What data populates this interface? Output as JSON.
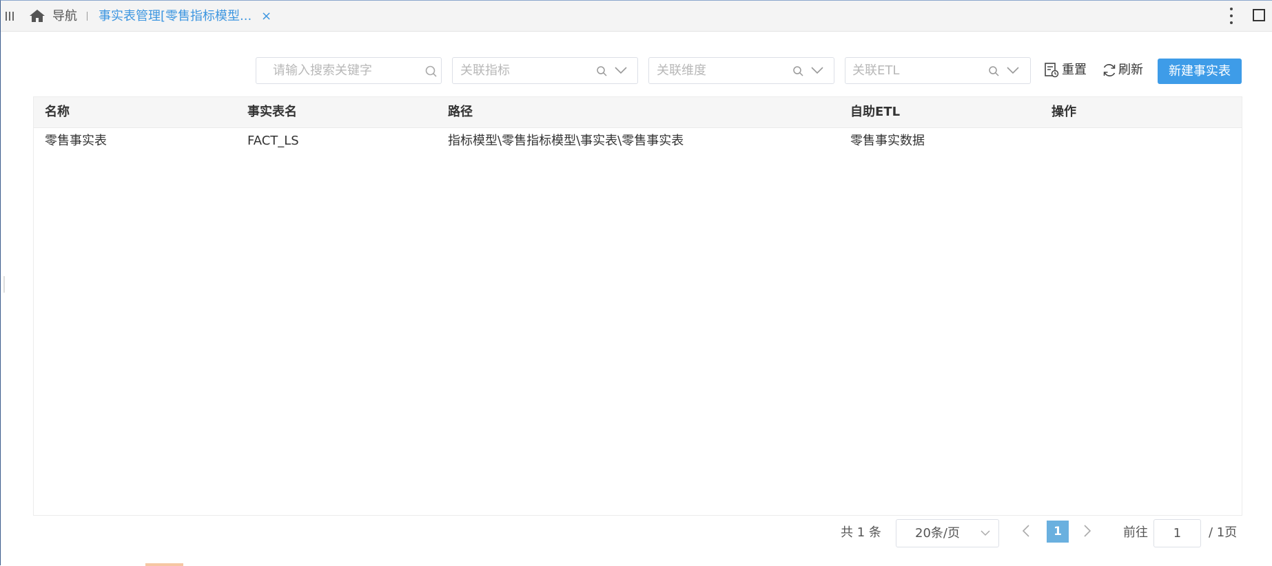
{
  "tabbar": {
    "home_label": "导航",
    "active_tab_label": "事实表管理[零售指标模型...",
    "close_symbol": "×"
  },
  "toolbar": {
    "search_placeholder": "请输入搜索关键字",
    "filter_metric_placeholder": "关联指标",
    "filter_dimension_placeholder": "关联维度",
    "filter_etl_placeholder": "关联ETL",
    "reset_label": "重置",
    "refresh_label": "刷新",
    "new_button_label": "新建事实表"
  },
  "table": {
    "columns": [
      "名称",
      "事实表名",
      "路径",
      "自助ETL",
      "操作"
    ],
    "rows": [
      [
        "零售事实表",
        "FACT_LS",
        "指标模型\\零售指标模型\\事实表\\零售事实表",
        "零售事实数据",
        ""
      ]
    ]
  },
  "pagination": {
    "total_text": "共 1 条",
    "page_size": "20条/页",
    "current_page": "1",
    "goto_label": "前往",
    "goto_value": "1",
    "total_pages_text": "/ 1页"
  },
  "icons": {
    "menu": "menu-lines-icon",
    "home": "home-icon",
    "search": "search-icon",
    "chevron": "chevron-down-icon",
    "reset": "reset-doc-icon",
    "refresh": "refresh-icon",
    "more": "kebab-icon",
    "maximize": "maximize-icon"
  },
  "colors": {
    "accent": "#3e9ce8",
    "active_tab": "#3d96e0",
    "current_page": "#6ab0df"
  }
}
